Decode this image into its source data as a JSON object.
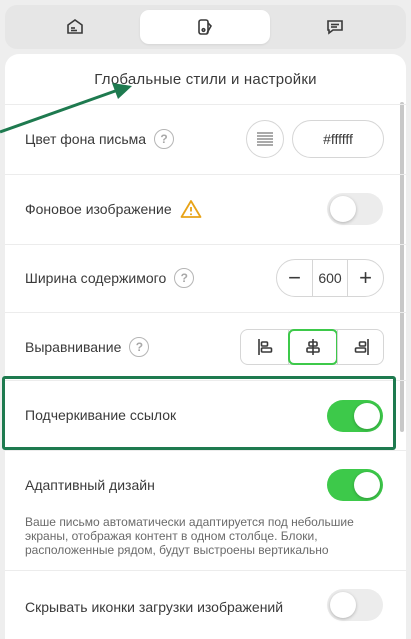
{
  "tabs": [
    {
      "icon": "email-template-icon"
    },
    {
      "icon": "styles-paint-icon"
    },
    {
      "icon": "comment-icon"
    }
  ],
  "panel": {
    "title": "Глобальные стили и настройки"
  },
  "settings": {
    "bg_color": {
      "label": "Цвет фона письма",
      "value": "#ffffff"
    },
    "bg_image": {
      "label": "Фоновое изображение",
      "enabled": false
    },
    "content_width": {
      "label": "Ширина содержимого",
      "value": "600",
      "minus": "−",
      "plus": "+"
    },
    "alignment": {
      "label": "Выравнивание",
      "options": [
        "left",
        "center",
        "right"
      ],
      "selected": "center"
    },
    "underline_links": {
      "label": "Подчеркивание ссылок",
      "enabled": true
    },
    "responsive": {
      "label": "Адаптивный дизайн",
      "enabled": true,
      "description": "Ваше письмо автоматически адаптируется под небольшие экраны, отображая контент в одном столбце. Блоки, расположенные рядом, будут выстроены вертикально"
    },
    "hide_image_icons": {
      "label": "Скрывать иконки загрузки изображений",
      "enabled": false
    }
  },
  "colors": {
    "accent_green": "#3dc94a",
    "annotation_green": "#1e7a4f",
    "warning": "#e8a317"
  }
}
